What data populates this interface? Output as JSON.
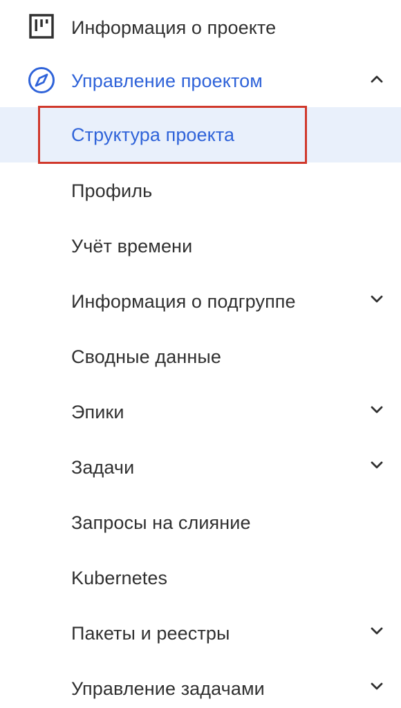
{
  "sidebar": {
    "project_info": {
      "label": "Информация о проекте",
      "icon": "board-icon"
    },
    "project_management": {
      "label": "Управление проектом",
      "icon": "compass-icon",
      "expanded": true
    },
    "sub_items": [
      {
        "label": "Структура проекта",
        "selected": true
      },
      {
        "label": "Профиль"
      },
      {
        "label": "Учёт времени"
      },
      {
        "label": "Информация о подгруппе",
        "has_submenu": true
      },
      {
        "label": "Сводные данные"
      },
      {
        "label": "Эпики",
        "has_submenu": true
      },
      {
        "label": "Задачи",
        "has_submenu": true
      },
      {
        "label": "Запросы на слияние"
      },
      {
        "label": "Kubernetes"
      },
      {
        "label": "Пакеты и реестры",
        "has_submenu": true
      },
      {
        "label": "Управление задачами",
        "has_submenu": true
      }
    ]
  },
  "colors": {
    "accent": "#2f63d9",
    "text": "#303030",
    "selected_bg": "#e9f0fb",
    "highlight_border": "#d0382b"
  }
}
